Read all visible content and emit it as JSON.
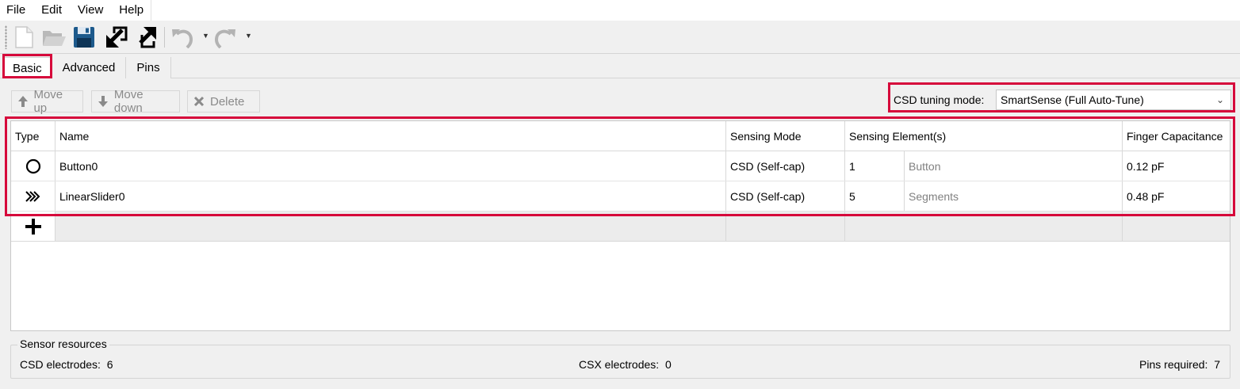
{
  "menu": {
    "items": [
      "File",
      "Edit",
      "View",
      "Help"
    ]
  },
  "toolbar": {
    "buttons": [
      "new-file-icon",
      "open-folder-icon",
      "save-icon",
      "import-icon",
      "export-icon",
      "undo-icon",
      "redo-icon"
    ]
  },
  "tabs": [
    {
      "label": "Basic",
      "active": true
    },
    {
      "label": "Advanced",
      "active": false
    },
    {
      "label": "Pins",
      "active": false
    }
  ],
  "actions": {
    "move_up": "Move up",
    "move_down": "Move down",
    "delete": "Delete"
  },
  "tuning": {
    "label": "CSD tuning mode:",
    "value": "SmartSense (Full Auto-Tune)"
  },
  "table": {
    "columns": [
      "Type",
      "Name",
      "Sensing Mode",
      "Sensing Element(s)",
      "Finger Capacitance"
    ],
    "rows": [
      {
        "type_icon": "button-circle-icon",
        "name": "Button0",
        "mode": "CSD (Self-cap)",
        "count": "1",
        "element": "Button",
        "capacitance": "0.12 pF"
      },
      {
        "type_icon": "slider-chevrons-icon",
        "name": "LinearSlider0",
        "mode": "CSD (Self-cap)",
        "count": "5",
        "element": "Segments",
        "capacitance": "0.48 pF"
      }
    ]
  },
  "resources": {
    "title": "Sensor resources",
    "csd": "CSD electrodes:  6",
    "csx": "CSX electrodes:  0",
    "pins": "Pins required:  7"
  },
  "colors": {
    "highlight": "#d6083b",
    "background": "#f0f0f0"
  }
}
